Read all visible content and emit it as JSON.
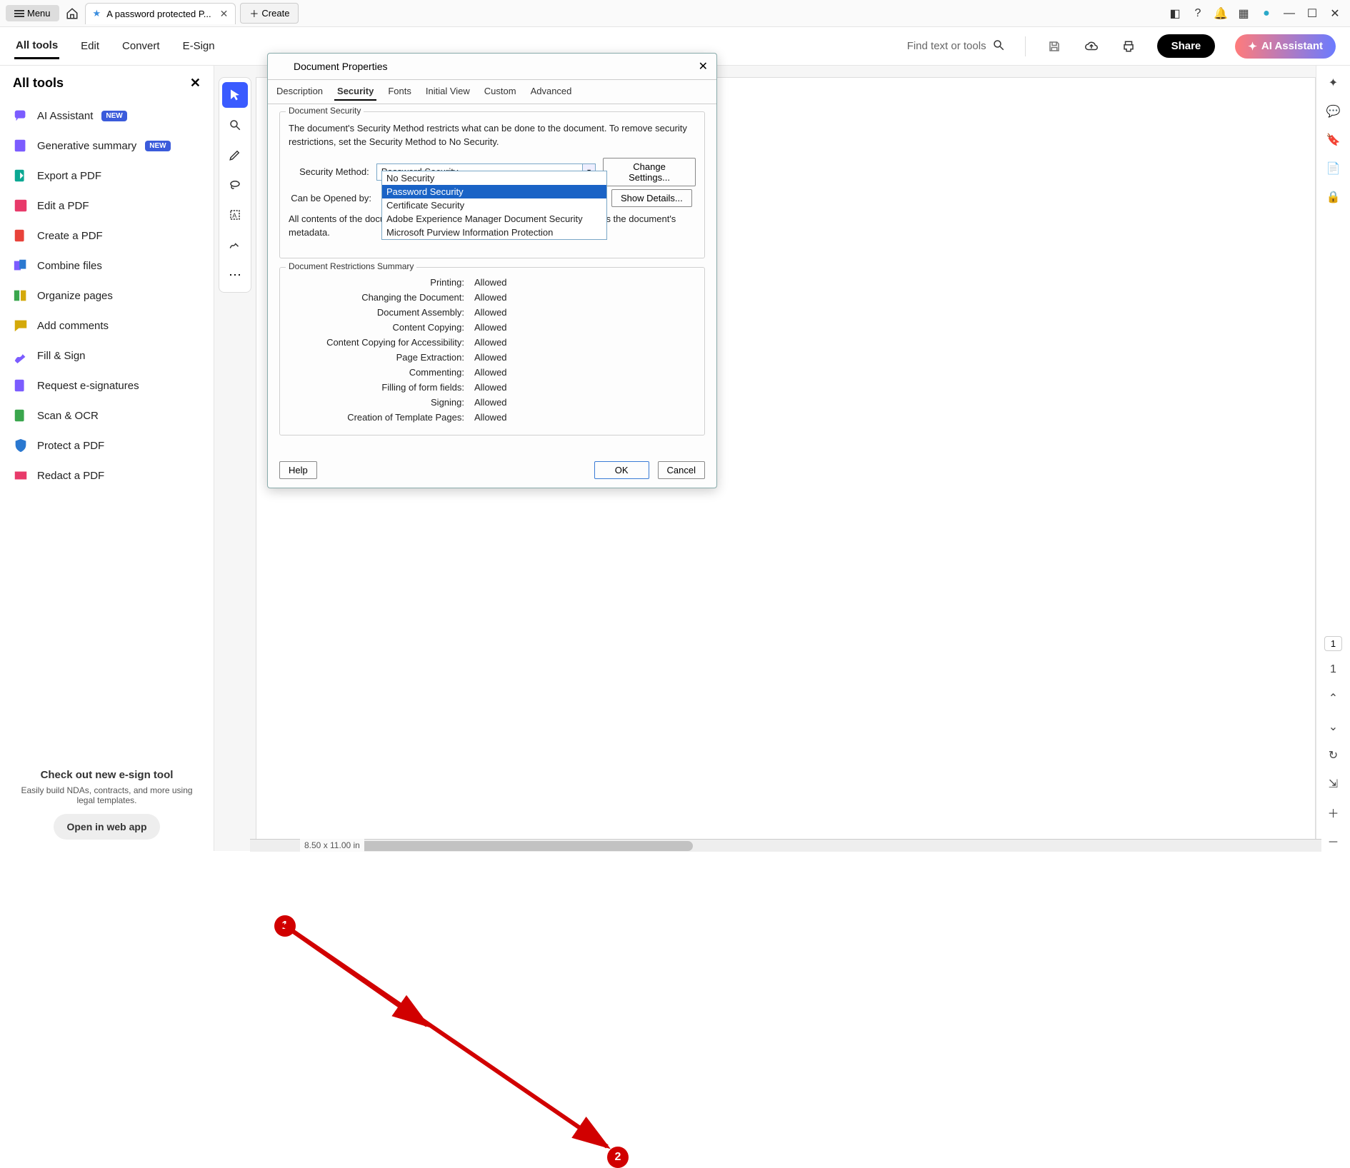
{
  "titlebar": {
    "menu": "Menu",
    "tab_title": "A password protected P...",
    "create": "Create"
  },
  "maintoolbar": {
    "items": [
      "All tools",
      "Edit",
      "Convert",
      "E-Sign"
    ],
    "search_placeholder": "Find text or tools",
    "share": "Share",
    "ai": "AI Assistant"
  },
  "sidebar": {
    "title": "All tools",
    "items": [
      {
        "label": "AI Assistant",
        "badge": "NEW"
      },
      {
        "label": "Generative summary",
        "badge": "NEW"
      },
      {
        "label": "Export a PDF"
      },
      {
        "label": "Edit a PDF"
      },
      {
        "label": "Create a PDF"
      },
      {
        "label": "Combine files"
      },
      {
        "label": "Organize pages"
      },
      {
        "label": "Add comments"
      },
      {
        "label": "Fill & Sign"
      },
      {
        "label": "Request e-signatures"
      },
      {
        "label": "Scan & OCR"
      },
      {
        "label": "Protect a PDF"
      },
      {
        "label": "Redact a PDF"
      }
    ],
    "footer": {
      "title": "Check out new e-sign tool",
      "desc": "Easily build NDAs, contracts, and more using legal templates.",
      "button": "Open in web app"
    }
  },
  "dialog": {
    "title": "Document Properties",
    "tabs": [
      "Description",
      "Security",
      "Fonts",
      "Initial View",
      "Custom",
      "Advanced"
    ],
    "active_tab": "Security",
    "security": {
      "legend": "Document Security",
      "desc": "The document's Security Method restricts what can be done to the document. To remove security restrictions, set the Security Method to No Security.",
      "method_label": "Security Method:",
      "method_value": "Password Security",
      "open_label": "Can be Opened by:",
      "change_btn": "Change Settings...",
      "details_btn": "Show Details...",
      "encrypt_note": "All contents of the document are encrypted and search engines cannot access the document's metadata.",
      "options": [
        "No Security",
        "Password Security",
        "Certificate Security",
        "Adobe Experience Manager Document Security",
        "Microsoft Purview Information Protection"
      ]
    },
    "restrictions": {
      "legend": "Document Restrictions Summary",
      "rows": [
        {
          "k": "Printing:",
          "v": "Allowed"
        },
        {
          "k": "Changing the Document:",
          "v": "Allowed"
        },
        {
          "k": "Document Assembly:",
          "v": "Allowed"
        },
        {
          "k": "Content Copying:",
          "v": "Allowed"
        },
        {
          "k": "Content Copying for Accessibility:",
          "v": "Allowed"
        },
        {
          "k": "Page Extraction:",
          "v": "Allowed"
        },
        {
          "k": "Commenting:",
          "v": "Allowed"
        },
        {
          "k": "Filling of form fields:",
          "v": "Allowed"
        },
        {
          "k": "Signing:",
          "v": "Allowed"
        },
        {
          "k": "Creation of Template Pages:",
          "v": "Allowed"
        }
      ]
    },
    "buttons": {
      "help": "Help",
      "ok": "OK",
      "cancel": "Cancel"
    }
  },
  "statusbar": {
    "page_size": "8.50 x 11.00 in"
  },
  "rightrail": {
    "page_current": "1",
    "page_total": "1"
  },
  "annotations": {
    "b1": "1",
    "b2": "2"
  }
}
